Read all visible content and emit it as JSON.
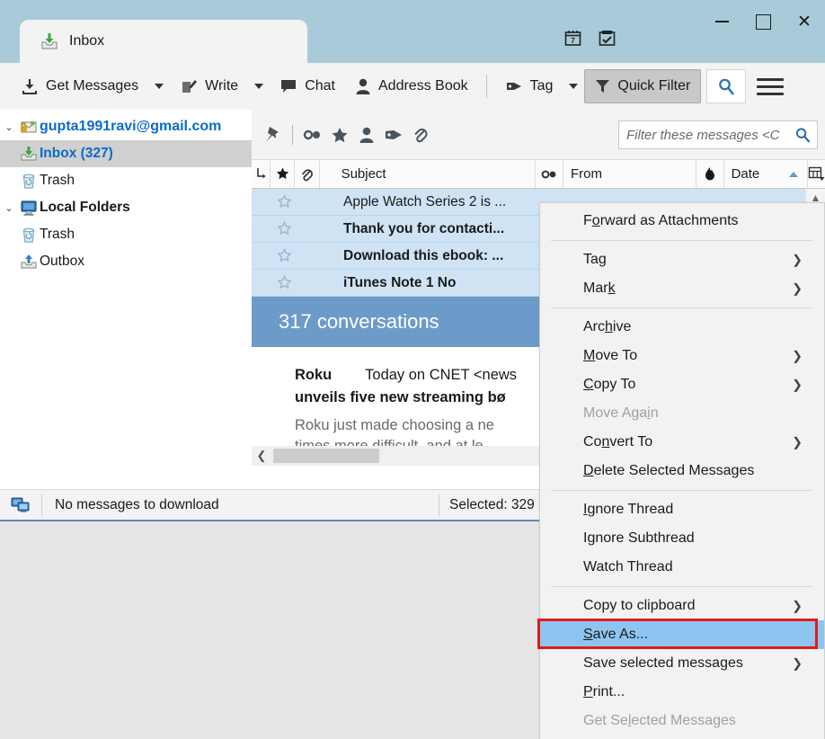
{
  "window": {
    "tab_label": "Inbox",
    "minimize_label": "Minimize",
    "maximize_label": "Maximize",
    "close_label": "✕",
    "calendar_icon": "calendar-icon",
    "tasks_icon": "tasks-icon",
    "titlebar_color": "#a9cbd9"
  },
  "toolbar": {
    "get_messages": "Get Messages",
    "write": "Write",
    "chat": "Chat",
    "address_book": "Address Book",
    "tag": "Tag",
    "quick_filter": "Quick Filter",
    "search_icon": "search-icon",
    "menu_icon": "hamburger-menu-icon",
    "quick_filter_active": true
  },
  "folder_pane": {
    "items": [
      {
        "label": "gupta1991ravi@gmail.com",
        "icon": "account-mail-icon",
        "indent": 0,
        "twisty": "⌄",
        "style": "account",
        "selected": false
      },
      {
        "label": "Inbox (327)",
        "icon": "inbox-icon",
        "indent": 1,
        "twisty": "",
        "style": "inbox",
        "selected": true
      },
      {
        "label": "Trash",
        "icon": "trash-icon",
        "indent": 1,
        "twisty": "",
        "style": "normal",
        "selected": false
      },
      {
        "label": "Local Folders",
        "icon": "local-folders-icon",
        "indent": 0,
        "twisty": "⌄",
        "style": "bold",
        "selected": false
      },
      {
        "label": "Trash",
        "icon": "trash-icon",
        "indent": 1,
        "twisty": "",
        "style": "normal",
        "selected": false
      },
      {
        "label": "Outbox",
        "icon": "outbox-icon",
        "indent": 1,
        "twisty": "",
        "style": "normal",
        "selected": false
      }
    ]
  },
  "quick_filter_bar": {
    "icons": [
      "pin-icon",
      "unread-icon",
      "starred-icon",
      "contact-icon",
      "tag-icon",
      "attachment-icon"
    ],
    "filter_placeholder": "Filter these messages <C",
    "filter_value": "",
    "search_icon": "search-icon"
  },
  "message_list": {
    "columns": [
      {
        "label": "",
        "icon": "thread-icon"
      },
      {
        "label": "",
        "icon": "star-icon"
      },
      {
        "label": "",
        "icon": "attachment-icon"
      },
      {
        "label": "Subject",
        "icon": ""
      },
      {
        "label": "",
        "icon": "unread-icon"
      },
      {
        "label": "From",
        "icon": ""
      },
      {
        "label": "",
        "icon": "junk-icon"
      },
      {
        "label": "Date",
        "icon": "",
        "sorted": "asc"
      },
      {
        "label": "",
        "icon": "column-picker-icon"
      }
    ],
    "rows": [
      {
        "subject": "Apple Watch Series 2 is ...",
        "unread": false,
        "starred": false,
        "selected": true
      },
      {
        "subject": "Thank you for contacti...",
        "unread": true,
        "starred": false,
        "selected": true
      },
      {
        "subject": "Download this ebook: ...",
        "unread": true,
        "starred": false,
        "selected": true
      },
      {
        "subject": "iTunes Note 1 No",
        "unread": true,
        "starred": false,
        "selected": true
      }
    ]
  },
  "conversation_banner": {
    "text": "317 conversations"
  },
  "preview": {
    "sender": "Roku",
    "line1_rest": "Today on CNET <news",
    "line2": "unveils five new streaming bø",
    "line3": "Roku just made choosing a ne",
    "line4": "times more difficult, and at le"
  },
  "status_bar": {
    "icon": "network-status-icon",
    "message": "No messages to download",
    "selected": "Selected: 329"
  },
  "context_menu": {
    "items": [
      {
        "label": "Forward as Attachments",
        "accesskey": "o",
        "submenu": false,
        "disabled": false,
        "highlighted": false
      },
      {
        "separator": true
      },
      {
        "label": "Tag",
        "accesskey": "g",
        "submenu": true,
        "disabled": false,
        "highlighted": false
      },
      {
        "label": "Mark",
        "accesskey": "k",
        "submenu": true,
        "disabled": false,
        "highlighted": false
      },
      {
        "separator": true
      },
      {
        "label": "Archive",
        "accesskey": "h",
        "submenu": false,
        "disabled": false,
        "highlighted": false
      },
      {
        "label": "Move To",
        "accesskey": "M",
        "submenu": true,
        "disabled": false,
        "highlighted": false
      },
      {
        "label": "Copy To",
        "accesskey": "C",
        "submenu": true,
        "disabled": false,
        "highlighted": false
      },
      {
        "label": "Move Again",
        "accesskey": "i",
        "submenu": false,
        "disabled": true,
        "highlighted": false
      },
      {
        "label": "Convert To",
        "accesskey": "n",
        "submenu": true,
        "disabled": false,
        "highlighted": false
      },
      {
        "label": "Delete Selected Messages",
        "accesskey": "D",
        "submenu": false,
        "disabled": false,
        "highlighted": false
      },
      {
        "separator": true
      },
      {
        "label": "Ignore Thread",
        "accesskey": "I",
        "submenu": false,
        "disabled": false,
        "highlighted": false
      },
      {
        "label": "Ignore Subthread",
        "accesskey": "",
        "submenu": false,
        "disabled": false,
        "highlighted": false
      },
      {
        "label": "Watch Thread",
        "accesskey": "",
        "submenu": false,
        "disabled": false,
        "highlighted": false
      },
      {
        "separator": true
      },
      {
        "label": "Copy to clipboard",
        "accesskey": "",
        "submenu": true,
        "disabled": false,
        "highlighted": false
      },
      {
        "label": "Save As...",
        "accesskey": "S",
        "submenu": false,
        "disabled": false,
        "highlighted": true
      },
      {
        "label": "Save selected messages",
        "accesskey": "",
        "submenu": true,
        "disabled": false,
        "highlighted": false
      },
      {
        "label": "Print...",
        "accesskey": "P",
        "submenu": false,
        "disabled": false,
        "highlighted": false
      },
      {
        "label": "Get Selected Messages",
        "accesskey": "l",
        "submenu": false,
        "disabled": true,
        "highlighted": false
      }
    ],
    "highlight_color": "#8ec5f0",
    "annotation_color": "#e01b1b"
  }
}
